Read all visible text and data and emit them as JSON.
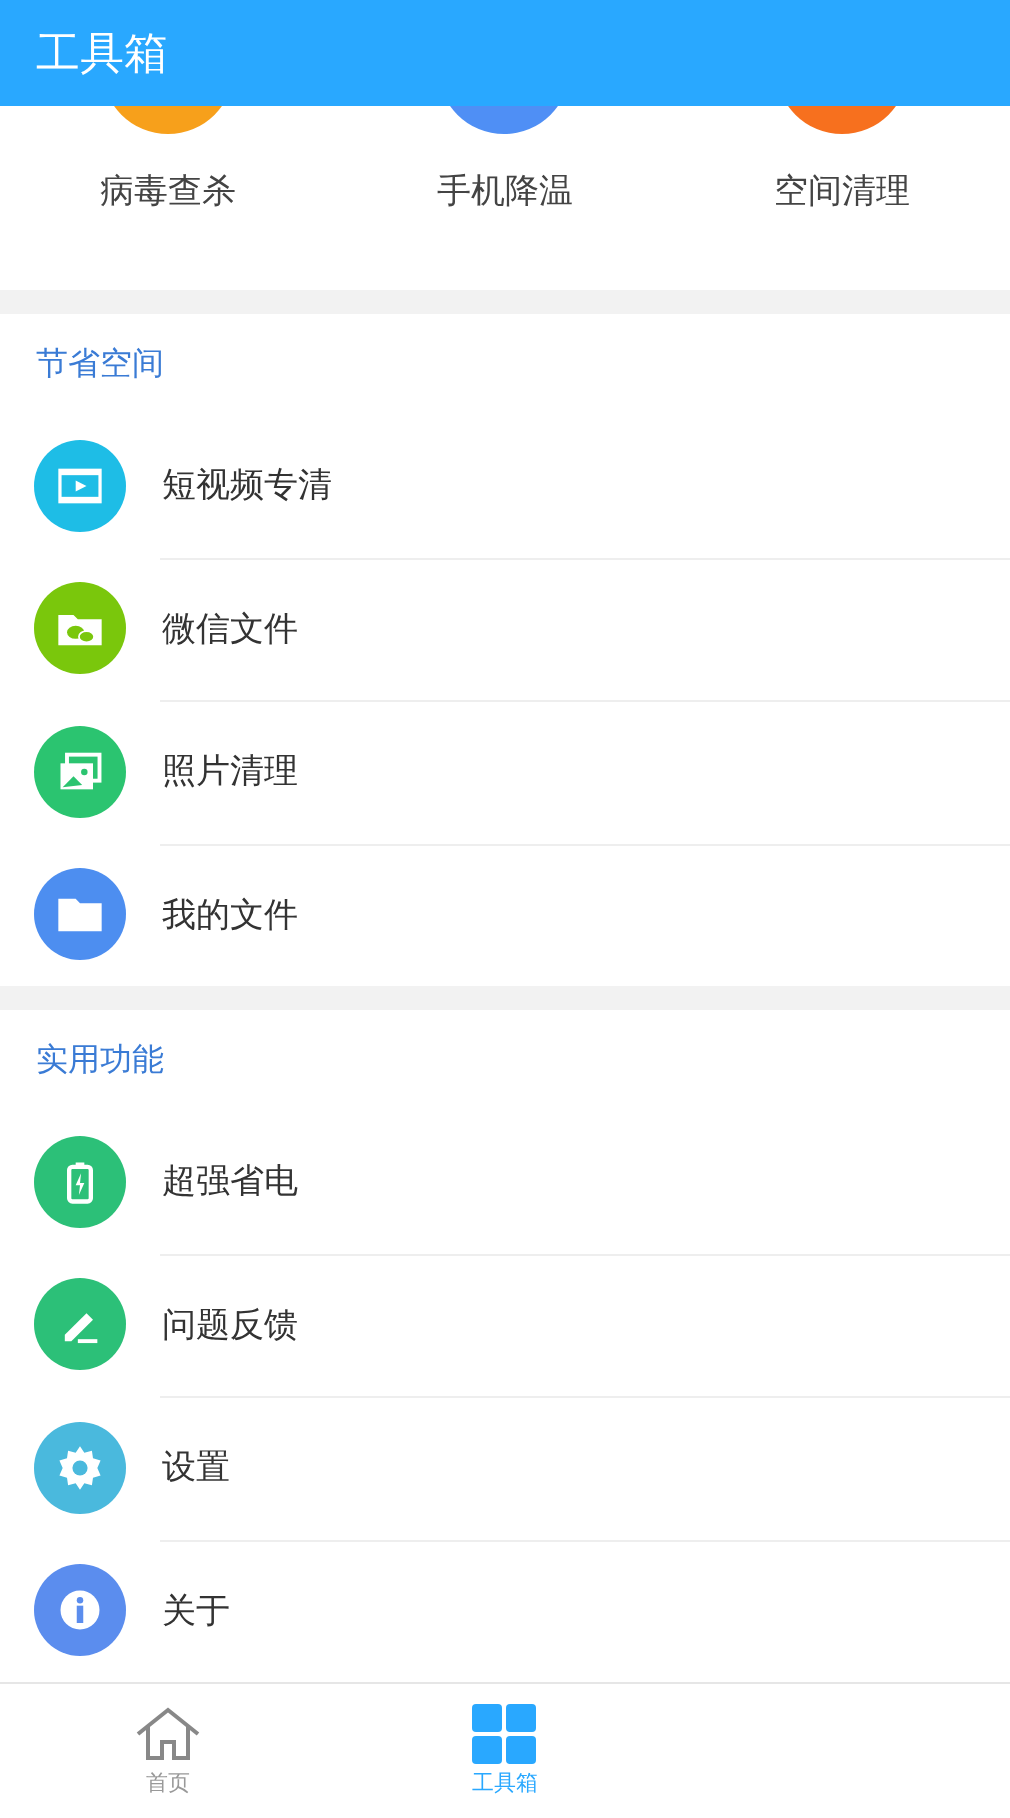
{
  "header": {
    "title": "工具箱"
  },
  "top_tools": [
    {
      "label": "病毒查杀",
      "color": "#f7a01b"
    },
    {
      "label": "手机降温",
      "color": "#4f8ff5"
    },
    {
      "label": "空间清理",
      "color": "#f7701e"
    }
  ],
  "sections": [
    {
      "title": "节省空间",
      "items": [
        {
          "label": "短视频专清",
          "kind": "video",
          "color": "#1ebde6"
        },
        {
          "label": "微信文件",
          "kind": "wechat",
          "color": "#7ac70c"
        },
        {
          "label": "照片清理",
          "kind": "photo",
          "color": "#2bc470"
        },
        {
          "label": "我的文件",
          "kind": "folder",
          "color": "#4d8ef0"
        }
      ]
    },
    {
      "title": "实用功能",
      "items": [
        {
          "label": "超强省电",
          "kind": "battery",
          "color": "#2cc078"
        },
        {
          "label": "问题反馈",
          "kind": "pencil",
          "color": "#2cc078"
        },
        {
          "label": "设置",
          "kind": "gear",
          "color": "#4ab9dd"
        },
        {
          "label": "关于",
          "kind": "info",
          "color": "#5b8dee"
        }
      ]
    }
  ],
  "tabs": [
    {
      "label": "首页",
      "kind": "home",
      "selected": false
    },
    {
      "label": "工具箱",
      "kind": "grid",
      "selected": true
    }
  ]
}
